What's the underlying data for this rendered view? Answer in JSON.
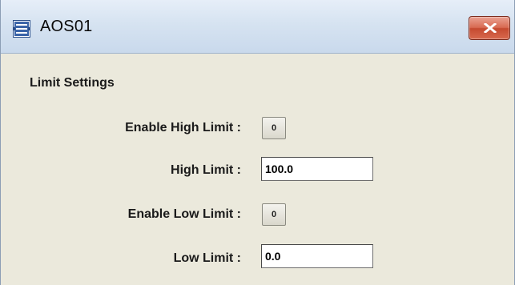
{
  "window": {
    "title": "AOS01",
    "icon": "function-block-icon",
    "close_icon": "close-x-icon"
  },
  "limit_settings": {
    "section_title": "Limit Settings",
    "enable_high_limit": {
      "label": "Enable High Limit :",
      "button_text": "0"
    },
    "high_limit": {
      "label": "High Limit :",
      "value": "100.0"
    },
    "enable_low_limit": {
      "label": "Enable Low Limit :",
      "button_text": "0"
    },
    "low_limit": {
      "label": "Low Limit :",
      "value": "0.0"
    }
  },
  "colors": {
    "close_button": "#d0553d",
    "panel_background": "#ebe9dc",
    "titlebar": "#d6e3f1"
  }
}
